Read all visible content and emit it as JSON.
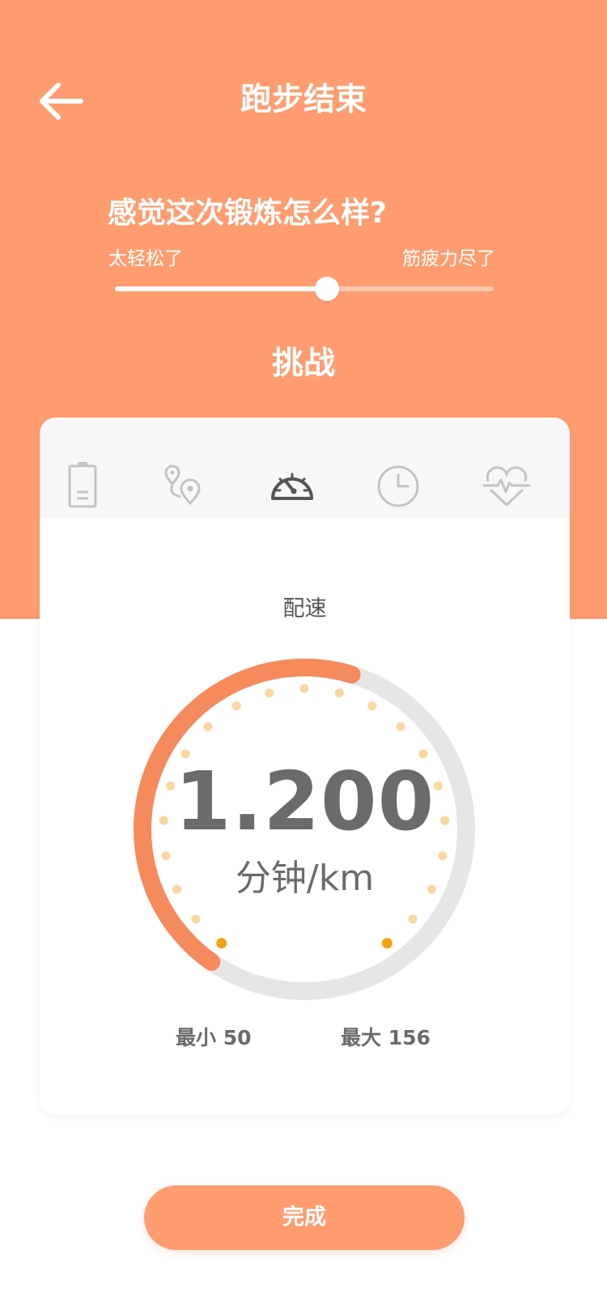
{
  "header": {
    "title": "跑步结束",
    "back_icon": "arrow-left-icon"
  },
  "feeling": {
    "question": "感觉这次锻炼怎么样?",
    "min_label": "太轻松了",
    "max_label": "筋疲力尽了",
    "value": 0.56
  },
  "section": {
    "title": "挑战"
  },
  "tabs": [
    {
      "icon": "battery-icon",
      "active": false
    },
    {
      "icon": "location-pins-icon",
      "active": false
    },
    {
      "icon": "speedometer-icon",
      "active": true
    },
    {
      "icon": "clock-icon",
      "active": false
    },
    {
      "icon": "heart-rate-icon",
      "active": false
    }
  ],
  "metric": {
    "label": "配速",
    "value": "1.200",
    "unit": "分钟/km",
    "min_label": "最小 50",
    "max_label": "最大 156",
    "progress": 0.45
  },
  "footer": {
    "done_label": "完成"
  },
  "colors": {
    "primary": "#FF9D70",
    "arc": "#F58B5C",
    "track": "#E6E6E6",
    "dot": "#FAD7A0",
    "dot_active": "#F2A30F",
    "text": "#6B6B6B"
  }
}
